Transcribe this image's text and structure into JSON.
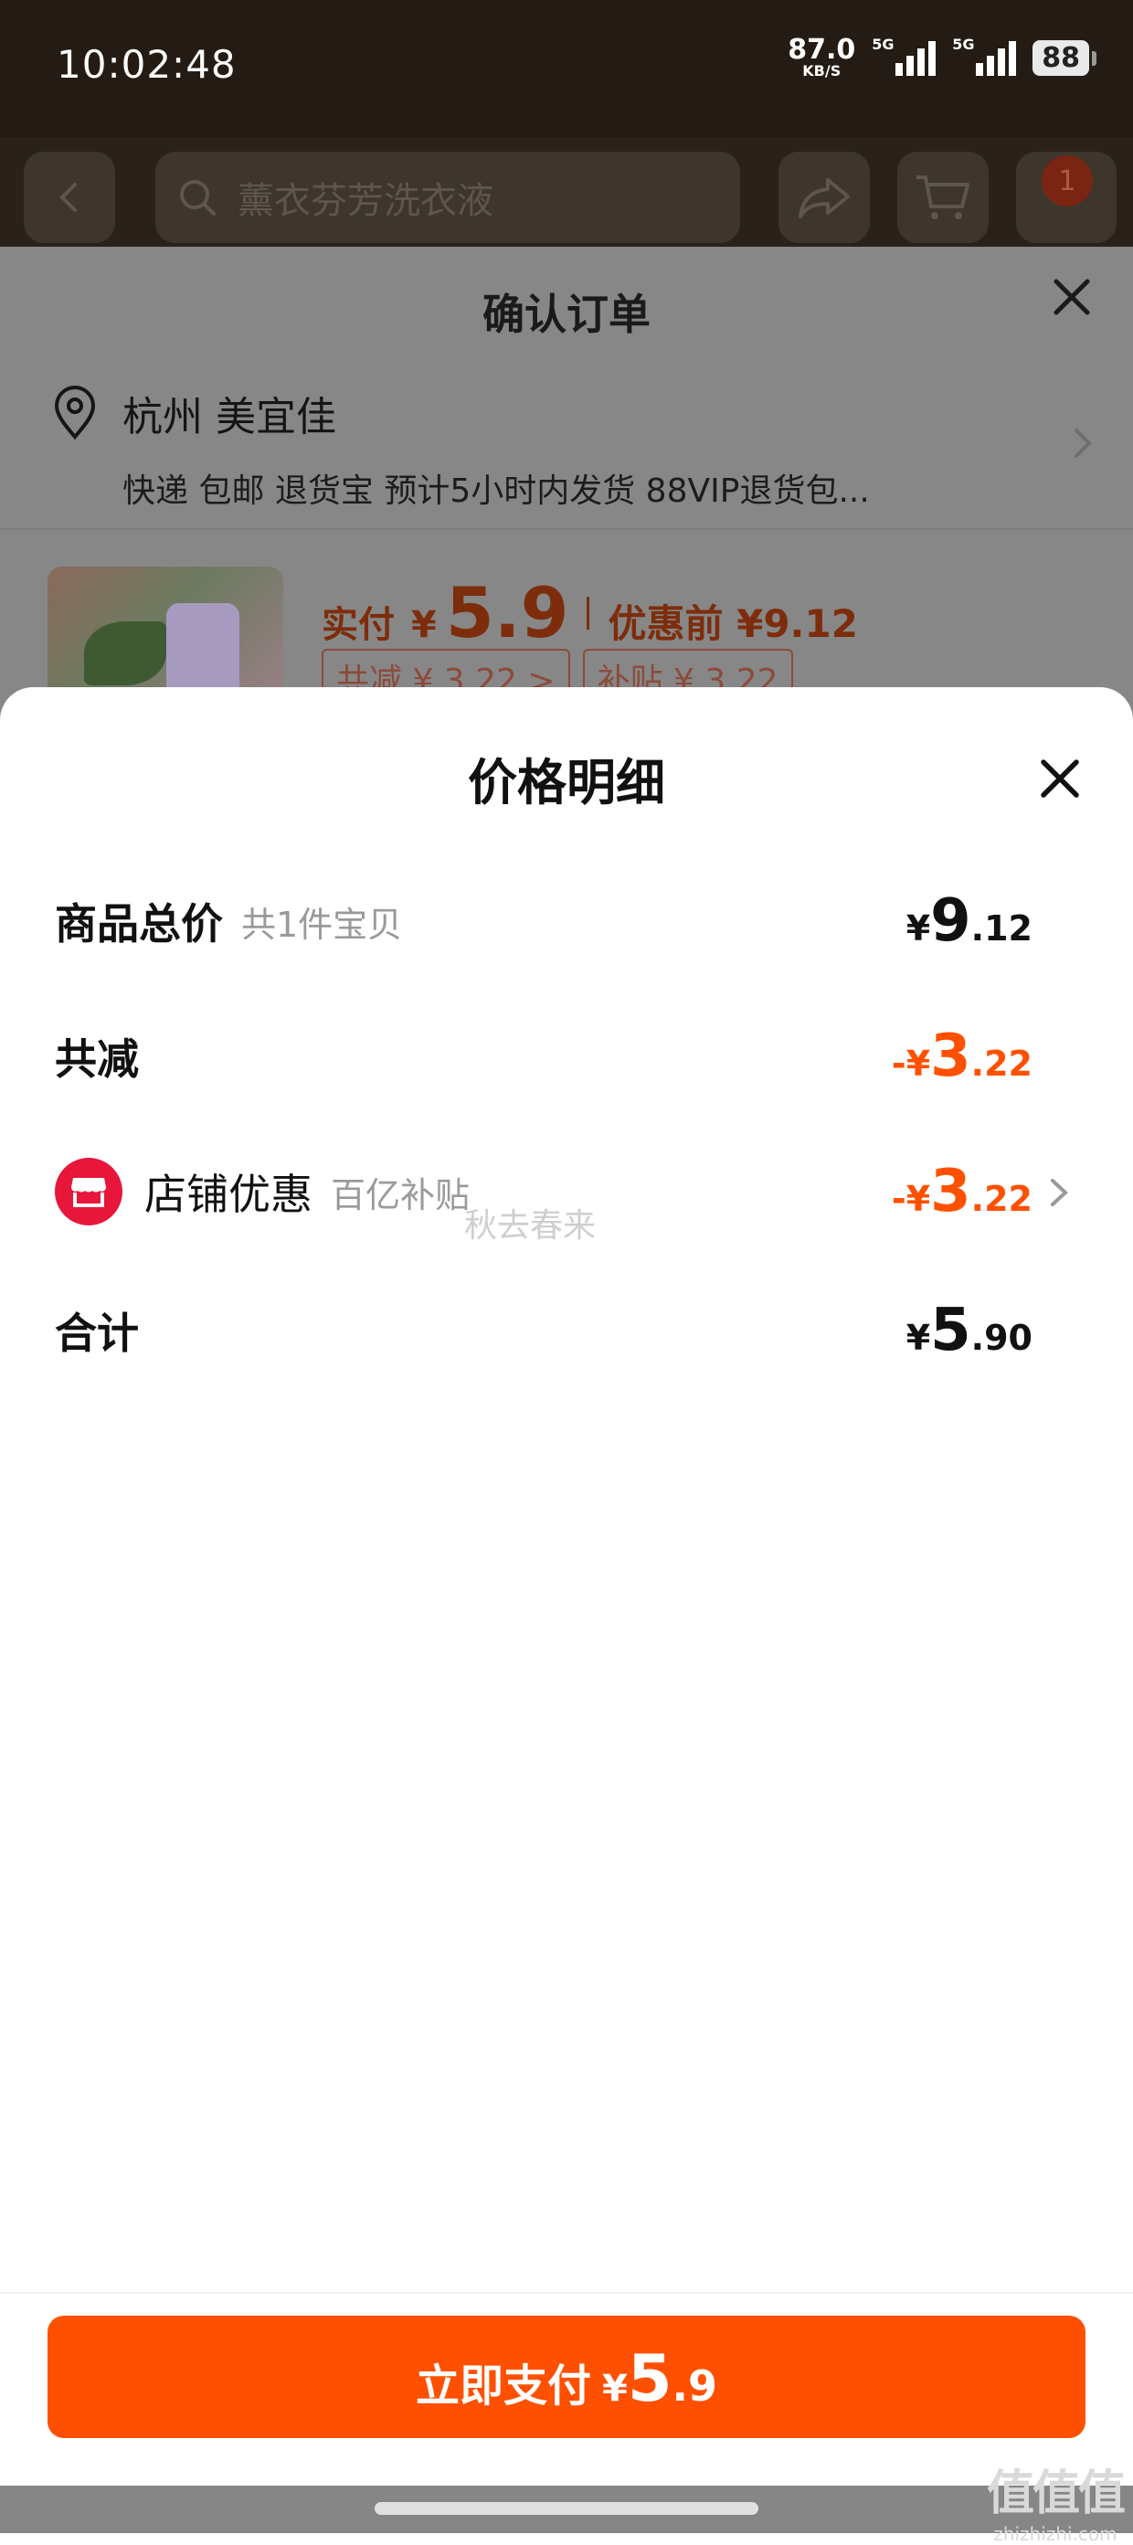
{
  "status_bar": {
    "time": "10:02:48",
    "net_speed": "87.0",
    "net_unit": "KB/S",
    "sim1_label": "5G",
    "sim2_label": "5G",
    "battery": "88"
  },
  "background_page": {
    "search_placeholder": "薰衣芬芳洗衣液",
    "cart_badge": "1",
    "order_title": "确认订单",
    "address_title": "杭州 美宜佳",
    "address_detail": "快递 包邮 退货宝 预计5小时内发货 88VIP退货包...",
    "pay_label": "实付",
    "pay_currency": "¥",
    "pay_amount": "5.9",
    "pre_discount": "优惠前 ¥9.12",
    "chip_total_reduce": "共减 ¥ 3.22 >",
    "chip_subsidy": "补贴 ¥ 3.22"
  },
  "price_detail": {
    "title": "价格明细",
    "items_total": {
      "label": "商品总价",
      "sub": "共1件宝贝",
      "currency": "¥",
      "int": "9",
      "dec": ".12"
    },
    "total_reduce": {
      "label": "共减",
      "currency": "-¥",
      "int": "3",
      "dec": ".22"
    },
    "shop_discount": {
      "label": "店铺优惠",
      "sub": "百亿补贴",
      "currency": "-¥",
      "int": "3",
      "dec": ".22"
    },
    "sum": {
      "label": "合计",
      "currency": "¥",
      "int": "5",
      "dec": ".90"
    },
    "watermark": "秋去春来"
  },
  "pay_bar": {
    "label": "立即支付",
    "currency": "¥",
    "int": "5",
    "dec": ".9"
  },
  "corner_brand": {
    "top": "值值值",
    "bottom": "zhizhizhi.com"
  },
  "colors": {
    "accent": "#ff5000",
    "shop_icon": "#e8163a"
  }
}
